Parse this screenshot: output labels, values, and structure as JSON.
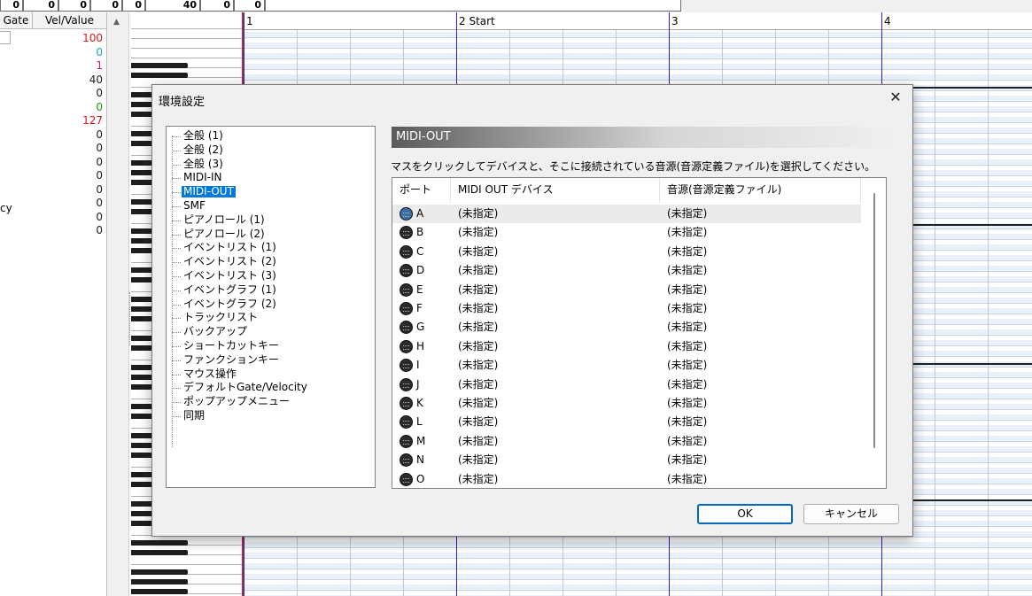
{
  "top_strip": {
    "values": [
      "0",
      "0",
      "0",
      "0",
      "0",
      "40",
      "0",
      "0"
    ]
  },
  "event_list": {
    "headers": [
      "Gate",
      "Vel/Value"
    ],
    "values": [
      {
        "v": "100",
        "c": "#d11a1a"
      },
      {
        "v": "0",
        "c": "#1a9ec0"
      },
      {
        "v": "1",
        "c": "#c0188f"
      },
      {
        "v": "40",
        "c": "#222222"
      },
      {
        "v": "0",
        "c": "#222222"
      },
      {
        "v": "0",
        "c": "#1a9a1a"
      },
      {
        "v": "127",
        "c": "#d11a1a"
      },
      {
        "v": "0",
        "c": "#222222"
      },
      {
        "v": "0",
        "c": "#222222"
      },
      {
        "v": "0",
        "c": "#222222"
      },
      {
        "v": "0",
        "c": "#222222"
      },
      {
        "v": "0",
        "c": "#222222"
      },
      {
        "v": "0",
        "c": "#222222"
      },
      {
        "v": "0",
        "c": "#222222"
      },
      {
        "v": "0",
        "c": "#222222"
      }
    ],
    "fragment": "cy"
  },
  "ruler": {
    "measures": [
      "1",
      "2 Start",
      "3",
      "4"
    ]
  },
  "dialog": {
    "title": "環境設定",
    "close_glyph": "✕",
    "tree": [
      "全般 (1)",
      "全般 (2)",
      "全般 (3)",
      "MIDI-IN",
      "MIDI-OUT",
      "SMF",
      "ピアノロール (1)",
      "ピアノロール (2)",
      "イベントリスト (1)",
      "イベントリスト (2)",
      "イベントリスト (3)",
      "イベントグラフ (1)",
      "イベントグラフ (2)",
      "トラックリスト",
      "バックアップ",
      "ショートカットキー",
      "ファンクションキー",
      "マウス操作",
      "デフォルトGate/Velocity",
      "ポップアップメニュー",
      "同期"
    ],
    "selected_tree_index": 4,
    "page_title": "MIDI-OUT",
    "description": "マスをクリックしてデバイスと、そこに接続されている音源(音源定義ファイル)を選択してください。",
    "columns": [
      "ポート",
      "MIDI OUT デバイス",
      "音源(音源定義ファイル)"
    ],
    "rows": [
      {
        "port": "A",
        "device": "(未指定)",
        "instrument": "(未指定)"
      },
      {
        "port": "B",
        "device": "(未指定)",
        "instrument": "(未指定)"
      },
      {
        "port": "C",
        "device": "(未指定)",
        "instrument": "(未指定)"
      },
      {
        "port": "D",
        "device": "(未指定)",
        "instrument": "(未指定)"
      },
      {
        "port": "E",
        "device": "(未指定)",
        "instrument": "(未指定)"
      },
      {
        "port": "F",
        "device": "(未指定)",
        "instrument": "(未指定)"
      },
      {
        "port": "G",
        "device": "(未指定)",
        "instrument": "(未指定)"
      },
      {
        "port": "H",
        "device": "(未指定)",
        "instrument": "(未指定)"
      },
      {
        "port": "I",
        "device": "(未指定)",
        "instrument": "(未指定)"
      },
      {
        "port": "J",
        "device": "(未指定)",
        "instrument": "(未指定)"
      },
      {
        "port": "K",
        "device": "(未指定)",
        "instrument": "(未指定)"
      },
      {
        "port": "L",
        "device": "(未指定)",
        "instrument": "(未指定)"
      },
      {
        "port": "M",
        "device": "(未指定)",
        "instrument": "(未指定)"
      },
      {
        "port": "N",
        "device": "(未指定)",
        "instrument": "(未指定)"
      },
      {
        "port": "O",
        "device": "(未指定)",
        "instrument": "(未指定)"
      }
    ],
    "ok_label": "OK",
    "cancel_label": "キャンセル",
    "accent_color": "#0078d7"
  }
}
